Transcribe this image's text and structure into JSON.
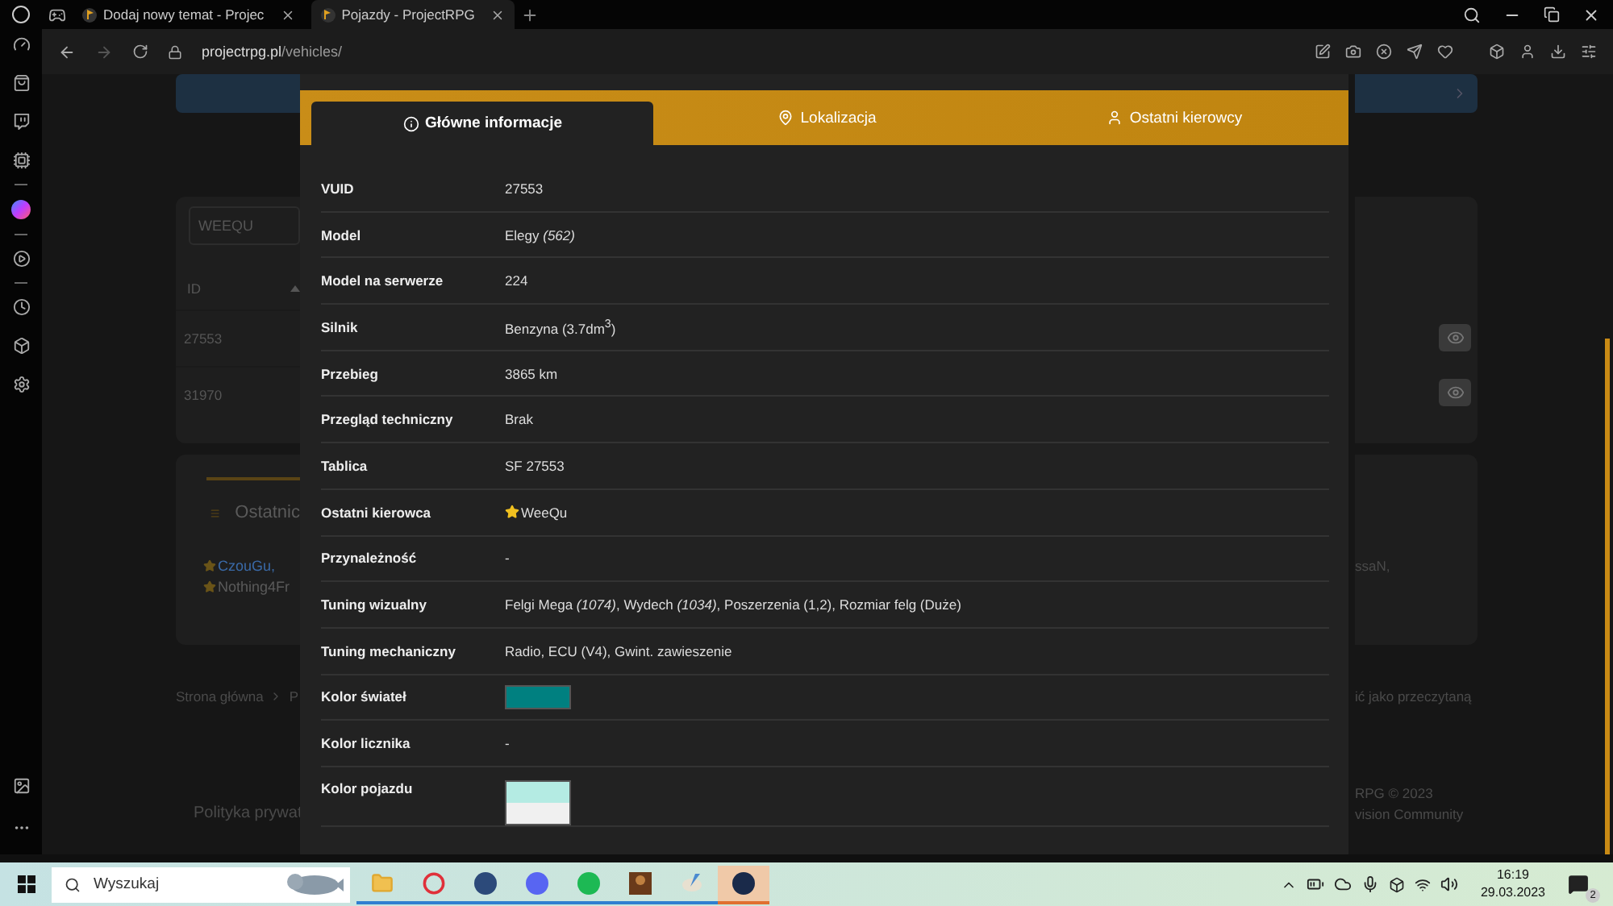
{
  "browser": {
    "tabs": [
      {
        "title": "Dodaj nowy temat - Projec",
        "selected": false
      },
      {
        "title": "Pojazdy - ProjectRPG",
        "selected": true
      }
    ],
    "url_host": "projectrpg.pl",
    "url_path": "/vehicles/"
  },
  "background": {
    "search_value": "WEEQU",
    "id_header": "ID",
    "ids": [
      "27553",
      "31970"
    ],
    "card_title": "Ostatnic",
    "players": [
      {
        "name": "CzouGu,",
        "color": "#3a6aa8"
      },
      {
        "name": "Nothing4Fr",
        "color": "#5a5a5a"
      }
    ],
    "players_right": "ssaN,",
    "breadcrumb": "Strona główna",
    "breadcrumb_next": "P",
    "mark_read": "ić jako przeczytaną",
    "footer_left": "Polityka prywat",
    "footer_right": [
      "RPG © 2023",
      "vision Community"
    ]
  },
  "modal": {
    "tabs": [
      {
        "label": "Główne informacje",
        "selected": true
      },
      {
        "label": "Lokalizacja",
        "selected": false
      },
      {
        "label": "Ostatni kierowcy",
        "selected": false
      }
    ],
    "rows": [
      {
        "label": "VUID",
        "kind": "text",
        "value": "27553"
      },
      {
        "label": "Model",
        "kind": "text",
        "value": "Elegy *(562)*"
      },
      {
        "label": "Model na serwerze",
        "kind": "text",
        "value": "224"
      },
      {
        "label": "Silnik",
        "kind": "text",
        "value": "Benzyna (3.7dm$^{3}$)"
      },
      {
        "label": "Przebieg",
        "kind": "text",
        "value": "3865 km"
      },
      {
        "label": "Przegląd techniczny",
        "kind": "text",
        "value": "Brak"
      },
      {
        "label": "Tablica",
        "kind": "text",
        "value": "SF 27553"
      },
      {
        "label": "Ostatni kierowca",
        "kind": "driver",
        "value": "WeeQu"
      },
      {
        "label": "Przynależność",
        "kind": "text",
        "value": "-"
      },
      {
        "label": "Tuning wizualny",
        "kind": "text",
        "value": "Felgi Mega *(1074)*, Wydech *(1034)*, Poszerzenia (1,2), Rozmiar felg (Duże)"
      },
      {
        "label": "Tuning mechaniczny",
        "kind": "text",
        "value": "Radio, ECU (V4), Gwint. zawieszenie"
      },
      {
        "label": "Kolor świateł",
        "kind": "color",
        "swatches": [
          {
            "color": "#008080"
          }
        ]
      },
      {
        "label": "Kolor licznika",
        "kind": "text",
        "value": "-"
      },
      {
        "label": "Kolor pojazdu",
        "kind": "color",
        "swatches": [
          {
            "color": "#b4ebe3"
          },
          {
            "color": "#f0f0f0"
          }
        ]
      }
    ]
  },
  "taskbar": {
    "search_placeholder": "Wyszukaj",
    "time": "16:19",
    "date": "29.03.2023",
    "notifications": "2"
  }
}
